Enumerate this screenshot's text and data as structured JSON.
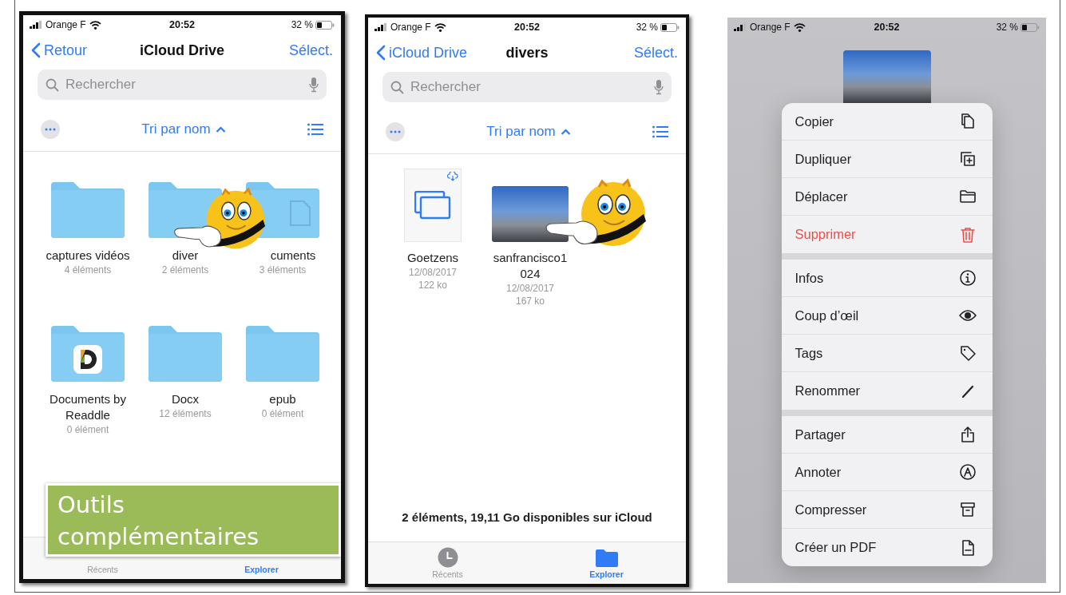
{
  "browse_screen": {
    "status_bar": {
      "carrier": "Orange F",
      "time": "20:52",
      "battery": "32 %"
    },
    "nav": {
      "back": "Retour",
      "title": "iCloud Drive",
      "action": "Sélect."
    },
    "search": {
      "placeholder": "Rechercher"
    },
    "sort": {
      "label": "Tri par nom"
    },
    "items": [
      {
        "kind": "folder",
        "name": "captures vidéos",
        "count": "4 éléments"
      },
      {
        "kind": "folder",
        "name": "diver",
        "count": "2 éléments"
      },
      {
        "kind": "documents-folder",
        "name": "cuments",
        "count": "3 éléments"
      },
      {
        "kind": "app-folder",
        "name": "Documents by Readdle",
        "count": "0 élément"
      },
      {
        "kind": "folder",
        "name": "Docx",
        "count": "12 éléments"
      },
      {
        "kind": "folder",
        "name": "epub",
        "count": "0 élément"
      }
    ],
    "tab_bar": [
      {
        "label": "Récents",
        "selected": false
      },
      {
        "label": "Explorer",
        "selected": true
      }
    ],
    "callout": "Outils complémentaires"
  },
  "folder_screen": {
    "status_bar": {
      "carrier": "Orange F",
      "time": "20:52",
      "battery": "32 %"
    },
    "nav": {
      "back": "iCloud Drive",
      "title": "divers",
      "action": "Sélect."
    },
    "search": {
      "placeholder": "Rechercher"
    },
    "sort": {
      "label": "Tri par nom"
    },
    "items": [
      {
        "kind": "file",
        "name": "Goetzens",
        "date": "12/08/2017",
        "size": "122 ko"
      },
      {
        "kind": "photo",
        "name": "sanfrancisco1024",
        "date": "12/08/2017",
        "size": "167 ko"
      }
    ],
    "footer": "2 éléments, 19,11 Go disponibles sur iCloud",
    "tab_bar": [
      {
        "kind": "recents",
        "label": "Récents",
        "selected": false
      },
      {
        "kind": "explorer",
        "label": "Explorer",
        "selected": true
      }
    ]
  },
  "menu_screen": {
    "status_bar": {
      "carrier": "Orange F",
      "time": "20:52",
      "battery": "32 %"
    },
    "menu": {
      "groups": [
        {
          "items": [
            {
              "label": "Copier",
              "kind": "normal"
            },
            {
              "label": "Dupliquer",
              "kind": "normal"
            },
            {
              "label": "Déplacer",
              "kind": "normal"
            },
            {
              "label": "Supprimer",
              "kind": "destructive"
            }
          ]
        },
        {
          "items": [
            {
              "label": "Infos",
              "kind": "normal"
            },
            {
              "label": "Coup d’œil",
              "kind": "normal"
            },
            {
              "label": "Tags",
              "kind": "normal"
            },
            {
              "label": "Renommer",
              "kind": "normal"
            }
          ]
        },
        {
          "items": [
            {
              "label": "Partager",
              "kind": "normal"
            },
            {
              "label": "Annoter",
              "kind": "normal"
            },
            {
              "label": "Compresser",
              "kind": "normal"
            },
            {
              "label": "Créer un PDF",
              "kind": "normal"
            }
          ]
        }
      ]
    }
  }
}
